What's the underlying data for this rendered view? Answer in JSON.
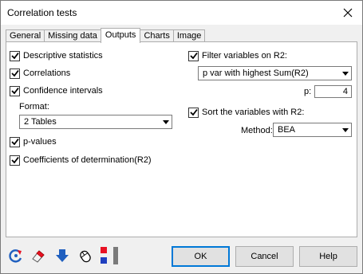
{
  "window": {
    "title": "Correlation tests"
  },
  "tabs": [
    {
      "label": "General",
      "active": false
    },
    {
      "label": "Missing data",
      "active": false
    },
    {
      "label": "Outputs",
      "active": true
    },
    {
      "label": "Charts",
      "active": false
    },
    {
      "label": "Image",
      "active": false
    }
  ],
  "left": {
    "descriptive": {
      "label": "Descriptive statistics",
      "checked": true
    },
    "correlations": {
      "label": "Correlations",
      "checked": true
    },
    "confidence": {
      "label": "Confidence intervals",
      "checked": true
    },
    "format_label": "Format:",
    "format_value": "2 Tables",
    "pvalues": {
      "label": "p-values",
      "checked": true
    },
    "coefficients": {
      "label": "Coefficients of determination(R2)",
      "checked": true
    }
  },
  "right": {
    "filter": {
      "label": "Filter variables on R2:",
      "checked": true
    },
    "filter_value": "p var with highest Sum(R2)",
    "p_label": "p:",
    "p_value": "4",
    "sort": {
      "label": "Sort the variables with R2:",
      "checked": true
    },
    "method_label": "Method:",
    "method_value": "BEA"
  },
  "buttons": {
    "ok": "OK",
    "cancel": "Cancel",
    "help": "Help"
  },
  "toolbar_icons": [
    "reset-icon",
    "eraser-icon",
    "download-arrow-icon",
    "mouse-icon",
    "color-toggle-icon"
  ],
  "colors": {
    "accent": "#0078d7",
    "arrow_blue": "#1f5fbf",
    "red": "#e81123"
  }
}
